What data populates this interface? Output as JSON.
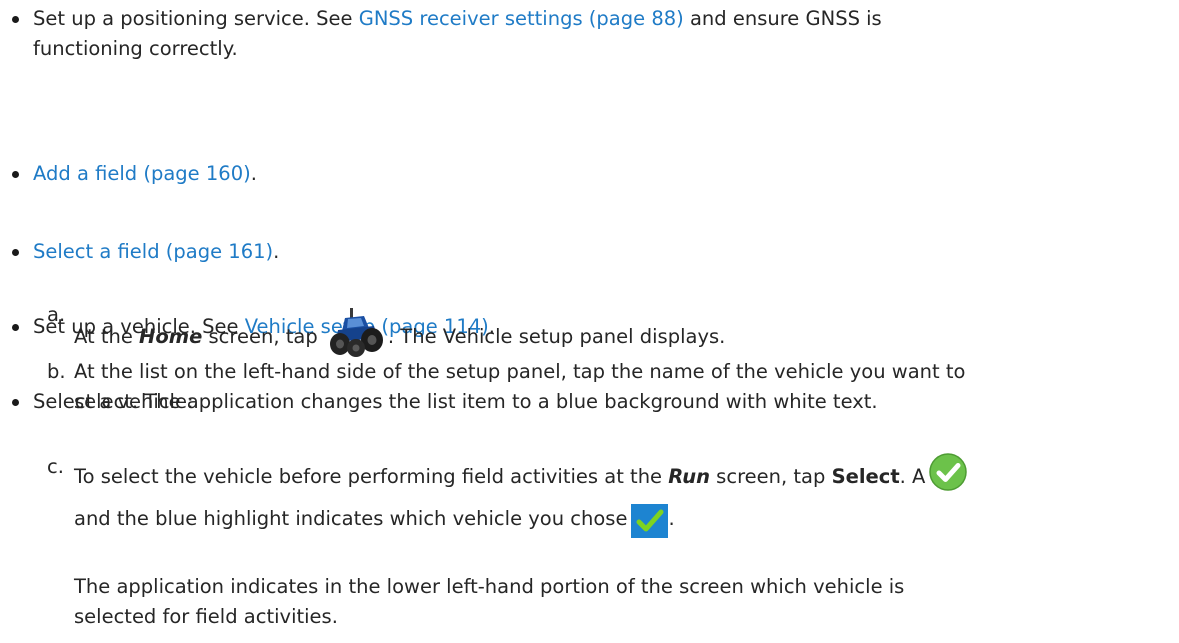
{
  "bullets": [
    {
      "prefix": "Set up a positioning service. See ",
      "link": "GNSS receiver settings (page 88)",
      "suffix": " and ensure GNSS is",
      "line2": "functioning correctly."
    },
    {
      "prefix": "",
      "link": "Add a field (page 160)",
      "suffix": "."
    },
    {
      "prefix": "",
      "link": "Select a field (page 161)",
      "suffix": "."
    },
    {
      "prefix": "Set up a vehicle. See ",
      "link": "Vehicle setup (page 114)",
      "suffix": "."
    },
    {
      "text": "Select a vehicle:"
    }
  ],
  "steps": [
    {
      "letter": "a.",
      "pre": "At the ",
      "bold": "Home",
      "mid": " screen, tap ",
      "icon": "tractor-icon",
      "post": ". The Vehicle setup panel displays."
    },
    {
      "letter": "b.",
      "line1": "At the list on the left-hand side of the setup panel, tap the name of the vehicle you want to",
      "line2": "select. The application changes the list item to a blue background with white text."
    },
    {
      "letter": "c.",
      "pre": "To select the vehicle before performing field activities at the ",
      "bold": "Run",
      "mid": " screen, tap ",
      "strong": "Select",
      "post": ". A",
      "icon1": "green-check-circle-icon",
      "line2": "and the blue highlight indicates which vehicle you chose",
      "icon2": "blue-check-square-icon",
      "line2_end": ".",
      "para2_line1": "The application indicates in the lower left-hand portion of the screen which vehicle is",
      "para2_line2": "selected for field activities."
    }
  ],
  "colors": {
    "link": "#1f7bc6",
    "text": "#262626",
    "check_green": "#6cc24a",
    "check_blue": "#1d84d1",
    "tractor_blue": "#1a4fa3"
  }
}
